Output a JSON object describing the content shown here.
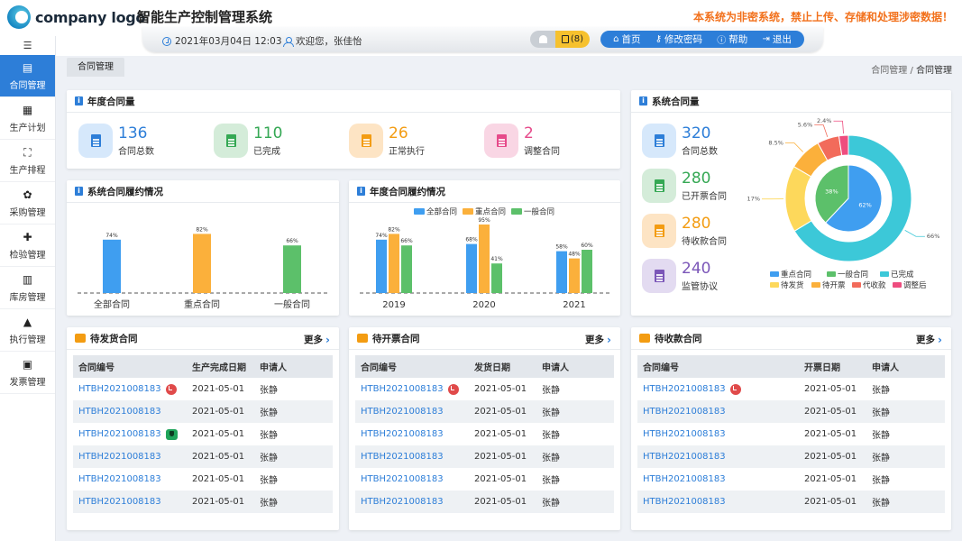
{
  "header": {
    "logo_text": "company logo",
    "system_title": "智能生产控制管理系统",
    "warning": "本系统为非密系统，禁止上传、存储和处理涉密数据！",
    "datetime": "2021年03月04日 12:03",
    "welcome": "欢迎您，张佳怡",
    "task_count": "(8)",
    "nav": [
      {
        "label": "首页",
        "icon": "home-icon"
      },
      {
        "label": "修改密码",
        "icon": "key-icon"
      },
      {
        "label": "帮助",
        "icon": "info-icon"
      },
      {
        "label": "退出",
        "icon": "logout-icon"
      }
    ]
  },
  "sidebar": {
    "items": [
      {
        "label": "合同管理",
        "icon": "contract-icon",
        "active": true
      },
      {
        "label": "生产计划",
        "icon": "plan-icon"
      },
      {
        "label": "生产排程",
        "icon": "schedule-icon"
      },
      {
        "label": "采购管理",
        "icon": "purchase-icon"
      },
      {
        "label": "检验管理",
        "icon": "puzzle-icon"
      },
      {
        "label": "库房管理",
        "icon": "warehouse-icon"
      },
      {
        "label": "执行管理",
        "icon": "stamp-icon"
      },
      {
        "label": "发票管理",
        "icon": "invoice-icon"
      }
    ]
  },
  "tabs": {
    "active": "合同管理"
  },
  "breadcrumb": {
    "parent": "合同管理",
    "separator": "/",
    "current": "合同管理"
  },
  "annual_stats": {
    "title": "年度合同量",
    "items": [
      {
        "value": "136",
        "label": "合同总数",
        "color": "#2d7ed8",
        "bg": "#d6e8fb"
      },
      {
        "value": "110",
        "label": "已完成",
        "color": "#35a854",
        "bg": "#d4ecd9"
      },
      {
        "value": "26",
        "label": "正常执行",
        "color": "#f39c12",
        "bg": "#fde4c4"
      },
      {
        "value": "2",
        "label": "调整合同",
        "color": "#e64a8a",
        "bg": "#f9d6e4"
      }
    ]
  },
  "system_stats": {
    "title": "系统合同量",
    "items": [
      {
        "value": "320",
        "label": "合同总数",
        "color": "#2d7ed8",
        "bg": "#d6e8fb"
      },
      {
        "value": "280",
        "label": "已开票合同",
        "color": "#35a854",
        "bg": "#d4ecd9"
      },
      {
        "value": "280",
        "label": "待收款合同",
        "color": "#f39c12",
        "bg": "#fde4c4"
      },
      {
        "value": "240",
        "label": "监管协议",
        "color": "#7b56b8",
        "bg": "#e3dbf1"
      }
    ]
  },
  "chart_data": [
    {
      "type": "bar",
      "title": "系统合同履约情况",
      "categories": [
        "全部合同",
        "重点合同",
        "一般合同"
      ],
      "values": [
        74,
        82,
        66
      ],
      "value_labels": [
        "74%",
        "82%",
        "66%"
      ],
      "colors": [
        "#3f9ef0",
        "#fbb03b",
        "#5cc06a"
      ],
      "ylim": [
        0,
        100
      ]
    },
    {
      "type": "bar",
      "title": "年度合同履约情况",
      "categories": [
        "2019",
        "2020",
        "2021"
      ],
      "series": [
        {
          "name": "全部合同",
          "values": [
            74,
            68,
            58
          ],
          "labels": [
            "74%",
            "68%",
            "58%"
          ],
          "color": "#3f9ef0"
        },
        {
          "name": "重点合同",
          "values": [
            82,
            95,
            48
          ],
          "labels": [
            "82%",
            "95%",
            "48%"
          ],
          "color": "#fbb03b"
        },
        {
          "name": "一般合同",
          "values": [
            66,
            41,
            60
          ],
          "labels": [
            "66%",
            "41%",
            "60%"
          ],
          "color": "#5cc06a"
        }
      ],
      "legend": "top",
      "ylim": [
        0,
        100
      ]
    },
    {
      "type": "pie",
      "rings": [
        {
          "name": "inner",
          "slices": [
            {
              "name": "重点合同",
              "value": 62,
              "label": "62%",
              "color": "#3f9ef0"
            },
            {
              "name": "一般合同",
              "value": 38,
              "label": "38%",
              "color": "#5cc06a"
            }
          ]
        },
        {
          "name": "outer",
          "slices": [
            {
              "name": "已完成",
              "value": 66,
              "label": "66%",
              "color": "#3cc8d8"
            },
            {
              "name": "待发货",
              "value": 17,
              "label": "17%",
              "color": "#fdd85b"
            },
            {
              "name": "待开票",
              "value": 8.5,
              "label": "8.5%",
              "color": "#fbb03b"
            },
            {
              "name": "代收款",
              "value": 5.6,
              "label": "5.6%",
              "color": "#f26b5b"
            },
            {
              "name": "调整后",
              "value": 2.4,
              "label": "2.4%",
              "color": "#ee4d7f"
            }
          ]
        }
      ],
      "legend": [
        "重点合同",
        "一般合同",
        "已完成",
        "待发货",
        "待开票",
        "代收款",
        "调整后"
      ],
      "legend_colors": [
        "#3f9ef0",
        "#5cc06a",
        "#3cc8d8",
        "#fdd85b",
        "#fbb03b",
        "#f26b5b",
        "#ee4d7f"
      ]
    }
  ],
  "tables": [
    {
      "title": "待发货合同",
      "icon_color": "#f39c12",
      "more": "更多",
      "headers": [
        "合同编号",
        "生产完成日期",
        "申请人"
      ],
      "rows": [
        {
          "id": "HTBH2021008183",
          "date": "2021-05-01",
          "applicant": "张静",
          "badge": "clock"
        },
        {
          "id": "HTBH2021008183",
          "date": "2021-05-01",
          "applicant": "张静",
          "badge": ""
        },
        {
          "id": "HTBH2021008183",
          "date": "2021-05-01",
          "applicant": "张静",
          "badge": "shield"
        },
        {
          "id": "HTBH2021008183",
          "date": "2021-05-01",
          "applicant": "张静",
          "badge": ""
        },
        {
          "id": "HTBH2021008183",
          "date": "2021-05-01",
          "applicant": "张静",
          "badge": ""
        },
        {
          "id": "HTBH2021008183",
          "date": "2021-05-01",
          "applicant": "张静",
          "badge": ""
        }
      ]
    },
    {
      "title": "待开票合同",
      "icon_color": "#f39c12",
      "more": "更多",
      "headers": [
        "合同编号",
        "发货日期",
        "申请人"
      ],
      "rows": [
        {
          "id": "HTBH2021008183",
          "date": "2021-05-01",
          "applicant": "张静",
          "badge": "clock"
        },
        {
          "id": "HTBH2021008183",
          "date": "2021-05-01",
          "applicant": "张静",
          "badge": ""
        },
        {
          "id": "HTBH2021008183",
          "date": "2021-05-01",
          "applicant": "张静",
          "badge": ""
        },
        {
          "id": "HTBH2021008183",
          "date": "2021-05-01",
          "applicant": "张静",
          "badge": ""
        },
        {
          "id": "HTBH2021008183",
          "date": "2021-05-01",
          "applicant": "张静",
          "badge": ""
        },
        {
          "id": "HTBH2021008183",
          "date": "2021-05-01",
          "applicant": "张静",
          "badge": ""
        }
      ]
    },
    {
      "title": "待收款合同",
      "icon_color": "#f39c12",
      "more": "更多",
      "headers": [
        "合同编号",
        "开票日期",
        "申请人"
      ],
      "rows": [
        {
          "id": "HTBH2021008183",
          "date": "2021-05-01",
          "applicant": "张静",
          "badge": "clock"
        },
        {
          "id": "HTBH2021008183",
          "date": "2021-05-01",
          "applicant": "张静",
          "badge": ""
        },
        {
          "id": "HTBH2021008183",
          "date": "2021-05-01",
          "applicant": "张静",
          "badge": ""
        },
        {
          "id": "HTBH2021008183",
          "date": "2021-05-01",
          "applicant": "张静",
          "badge": ""
        },
        {
          "id": "HTBH2021008183",
          "date": "2021-05-01",
          "applicant": "张静",
          "badge": ""
        },
        {
          "id": "HTBH2021008183",
          "date": "2021-05-01",
          "applicant": "张静",
          "badge": ""
        }
      ]
    }
  ]
}
